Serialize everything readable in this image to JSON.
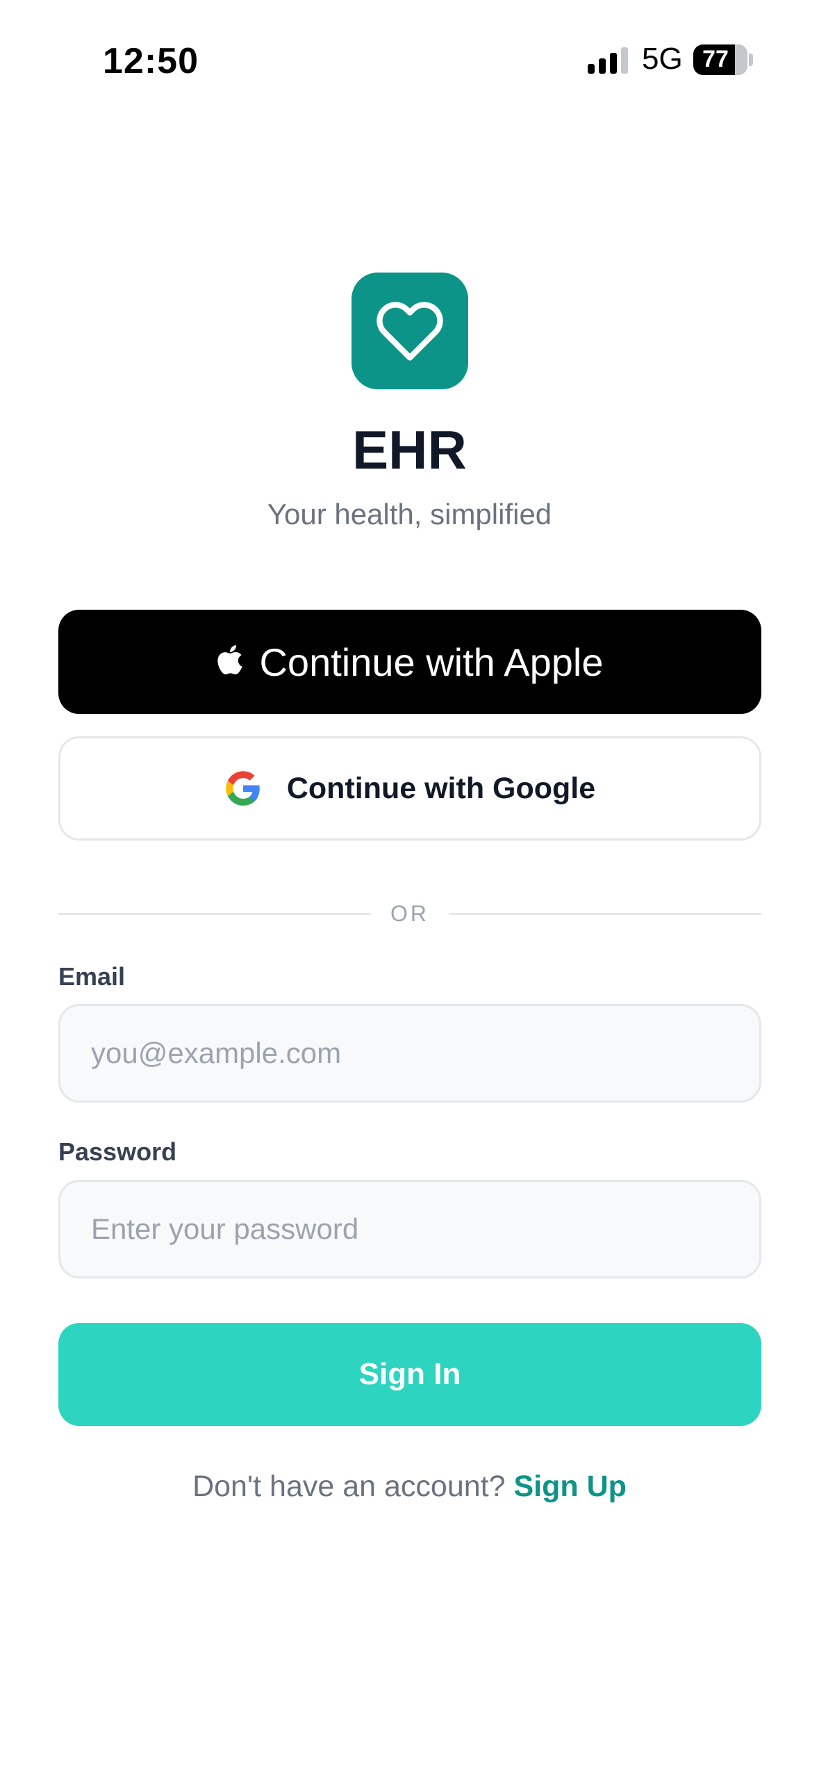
{
  "status_bar": {
    "time": "12:50",
    "network": "5G",
    "battery": "77",
    "signal_bars_active": 3,
    "signal_bars_total": 4
  },
  "logo": {
    "icon": "heart-icon",
    "background": "#0d9488"
  },
  "app": {
    "title": "EHR",
    "tagline": "Your health, simplified"
  },
  "auth": {
    "apple_label": "Continue with Apple",
    "google_label": "Continue with Google",
    "divider": "OR"
  },
  "form": {
    "email_label": "Email",
    "email_placeholder": "you@example.com",
    "email_value": "",
    "password_label": "Password",
    "password_placeholder": "Enter your password",
    "password_value": "",
    "submit_label": "Sign In"
  },
  "footer": {
    "prompt": "Don't have an account?",
    "signup_label": "Sign Up"
  },
  "colors": {
    "brand": "#0d9488",
    "primary_button": "#2dd4bf",
    "title_text": "#111827",
    "muted_text": "#6b7280"
  }
}
